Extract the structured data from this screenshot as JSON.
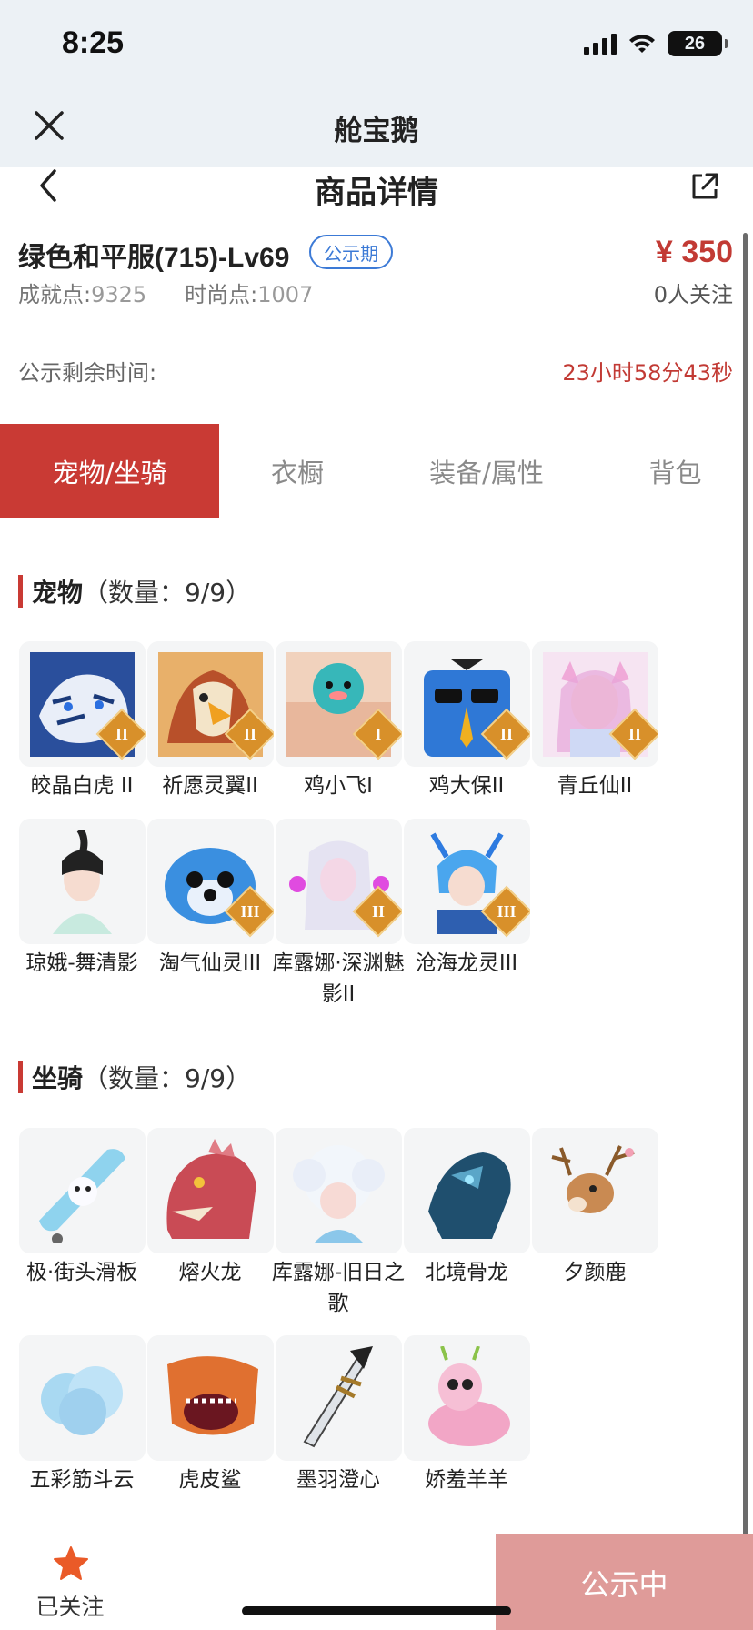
{
  "status_bar": {
    "time": "8:25",
    "battery": "26"
  },
  "app": {
    "title": "舱宝鹅"
  },
  "nav": {
    "title": "商品详情"
  },
  "product": {
    "name": "绿色和平服(715)-Lv69",
    "badge": "公示期",
    "price": "¥ 350",
    "achievement_label": "成就点:",
    "achievement_value": "9325",
    "fashion_label": "时尚点:",
    "fashion_value": "1007",
    "followers": "0人关注"
  },
  "remain": {
    "label": "公示剩余时间:",
    "value": "23小时58分43秒"
  },
  "tabs": [
    {
      "label": "宠物/坐骑",
      "active": true
    },
    {
      "label": "衣橱",
      "active": false
    },
    {
      "label": "装备/属性",
      "active": false
    },
    {
      "label": "背包",
      "active": false
    }
  ],
  "pets": {
    "title": "宠物",
    "count": "（数量：9/9）",
    "items": [
      {
        "name": "皎晶白虎 II",
        "tier": "II",
        "art": "white-tiger"
      },
      {
        "name": "祈愿灵翼II",
        "tier": "II",
        "art": "eagle"
      },
      {
        "name": "鸡小飞I",
        "tier": "I",
        "art": "chick"
      },
      {
        "name": "鸡大保II",
        "tier": "II",
        "art": "blue-bird"
      },
      {
        "name": "青丘仙II",
        "tier": "II",
        "art": "fox-fairy"
      },
      {
        "name": "琼娥-舞清影",
        "tier": "",
        "art": "dancer"
      },
      {
        "name": "淘气仙灵III",
        "tier": "III",
        "art": "blue-dog"
      },
      {
        "name": "库露娜·深渊魅影II",
        "tier": "II",
        "art": "white-spirit"
      },
      {
        "name": "沧海龙灵III",
        "tier": "III",
        "art": "dragon-boy"
      }
    ]
  },
  "mounts": {
    "title": "坐骑",
    "count": "（数量：9/9）",
    "items": [
      {
        "name": "极·街头滑板",
        "art": "skateboard"
      },
      {
        "name": "熔火龙",
        "art": "red-dragon"
      },
      {
        "name": "库露娜-旧日之歌",
        "art": "cloud-girl"
      },
      {
        "name": "北境骨龙",
        "art": "bone-dragon"
      },
      {
        "name": "夕颜鹿",
        "art": "deer"
      },
      {
        "name": "五彩筋斗云",
        "art": "cloud"
      },
      {
        "name": "虎皮鲨",
        "art": "shark"
      },
      {
        "name": "墨羽澄心",
        "art": "blade"
      },
      {
        "name": "娇羞羊羊",
        "art": "pink-sheep"
      }
    ]
  },
  "bottom": {
    "follow_label": "已关注",
    "status_label": "公示中"
  },
  "colors": {
    "accent": "#c93a34",
    "price": "#c23a34",
    "badge": "#3c7ad6",
    "status_button": "#df9b99"
  }
}
